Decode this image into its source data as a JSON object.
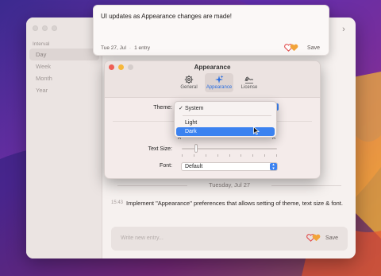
{
  "colors": {
    "accent": "#3b82f0",
    "close": "#ee5e55",
    "minimize": "#f6b73b"
  },
  "sidebar": {
    "header": "Interval",
    "items": [
      {
        "label": "Day",
        "active": true
      },
      {
        "label": "Week",
        "active": false
      },
      {
        "label": "Month",
        "active": false
      },
      {
        "label": "Year",
        "active": false
      }
    ]
  },
  "editor": {
    "text": "UI updates as Appearance changes are made!",
    "date": "Tue 27, Jul",
    "separator": "·",
    "count": "1 entry",
    "save_label": "Save"
  },
  "prefs": {
    "title": "Appearance",
    "tabs": [
      {
        "label": "General",
        "icon": "gear-icon"
      },
      {
        "label": "Appearance",
        "icon": "sparkles-icon",
        "active": true
      },
      {
        "label": "License",
        "icon": "signature-icon"
      }
    ],
    "theme_label": "Theme:",
    "text_size_label": "Text Size:",
    "font_label": "Font:",
    "font_value": "Default",
    "text_size_small": "A",
    "text_size_large": "A"
  },
  "theme_menu": {
    "items": [
      {
        "label": "System",
        "checked": true
      },
      {
        "label": "Light"
      },
      {
        "label": "Dark",
        "highlighted": true
      }
    ],
    "check_glyph": "✓"
  },
  "timeline": {
    "date_header": "Tuesday, Jul 27",
    "entries": [
      {
        "time": "15:43",
        "text": "Implement \"Appearance\" preferences that allows setting of theme, text size & font."
      }
    ]
  },
  "composer": {
    "placeholder": "Write new entry...",
    "save_label": "Save"
  }
}
